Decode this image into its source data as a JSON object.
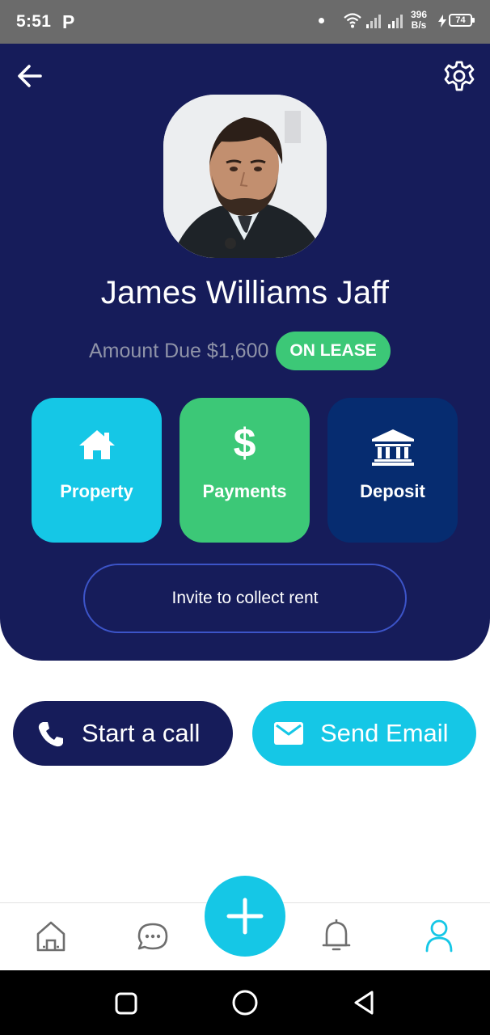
{
  "status_bar": {
    "time": "5:51",
    "app_letter": "P",
    "net_speed_value": "396",
    "net_speed_unit": "B/s",
    "battery": "74"
  },
  "header": {
    "back_icon": "arrow-left-icon",
    "settings_icon": "gear-icon"
  },
  "profile": {
    "name": "James Williams Jaff",
    "amount_due": "Amount Due $1,600",
    "status_badge": "ON LEASE"
  },
  "actions": [
    {
      "label": "Property",
      "icon": "home-icon",
      "color": "#15c7e6"
    },
    {
      "label": "Payments",
      "icon": "dollar-icon",
      "color": "#3cc877"
    },
    {
      "label": "Deposit",
      "icon": "bank-icon",
      "color": "#062c70"
    }
  ],
  "invite_button": "Invite to collect rent",
  "contact": {
    "call_label": "Start a call",
    "email_label": "Send Email"
  },
  "bottom_nav": [
    "home-icon",
    "chat-icon",
    "add-icon",
    "bell-icon",
    "profile-icon"
  ],
  "colors": {
    "navy": "#161c5a",
    "cyan": "#15c7e6",
    "green": "#3cc877",
    "deposit_blue": "#062c70"
  }
}
